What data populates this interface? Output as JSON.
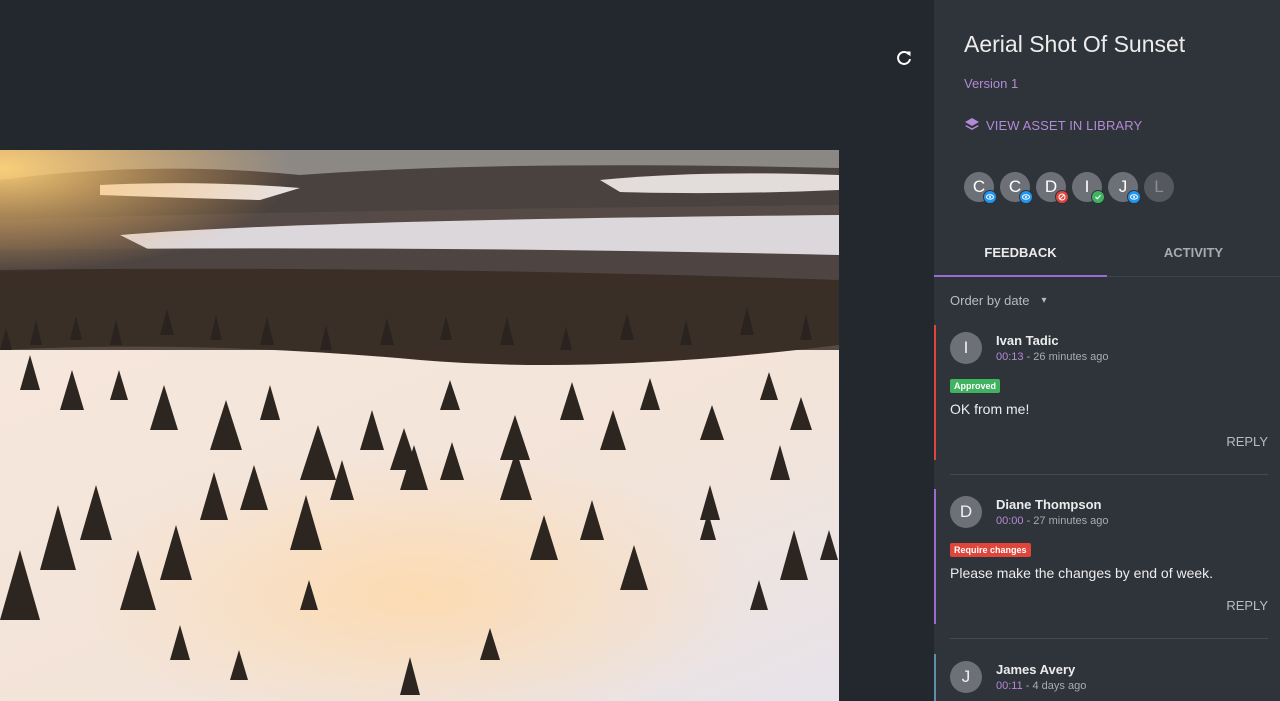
{
  "asset": {
    "title": "Aerial Shot Of Sunset",
    "version": "Version 1",
    "view_link": "VIEW ASSET IN LIBRARY"
  },
  "icons": {
    "refresh": "refresh-icon",
    "layers": "layers-icon"
  },
  "reviewers": [
    {
      "initial": "C",
      "status": "viewed"
    },
    {
      "initial": "C",
      "status": "viewed"
    },
    {
      "initial": "D",
      "status": "changes-required"
    },
    {
      "initial": "I",
      "status": "approved"
    },
    {
      "initial": "J",
      "status": "viewed"
    },
    {
      "initial": "L",
      "status": "none"
    }
  ],
  "tabs": [
    {
      "label": "FEEDBACK",
      "active": true
    },
    {
      "label": "ACTIVITY",
      "active": false
    }
  ],
  "order": {
    "label": "Order by date"
  },
  "comments": [
    {
      "initial": "I",
      "author": "Ivan Tadic",
      "timecode": "00:13",
      "time_ago": " - 26 minutes ago",
      "badge": "Approved",
      "text": "OK from me!",
      "reply": "REPLY"
    },
    {
      "initial": "D",
      "author": "Diane Thompson",
      "timecode": "00:00",
      "time_ago": " - 27 minutes ago",
      "badge": "Require changes",
      "text": "Please make the changes by end of week.",
      "reply": "REPLY"
    },
    {
      "initial": "J",
      "author": "James Avery",
      "timecode": "00:11",
      "time_ago": " - 4 days ago"
    }
  ],
  "colors": {
    "background": "#23272e",
    "panel": "#2f333a",
    "accent": "#b38ad6",
    "approved": "#3fb35f",
    "changes": "#e0453c",
    "viewed": "#2196f3"
  }
}
